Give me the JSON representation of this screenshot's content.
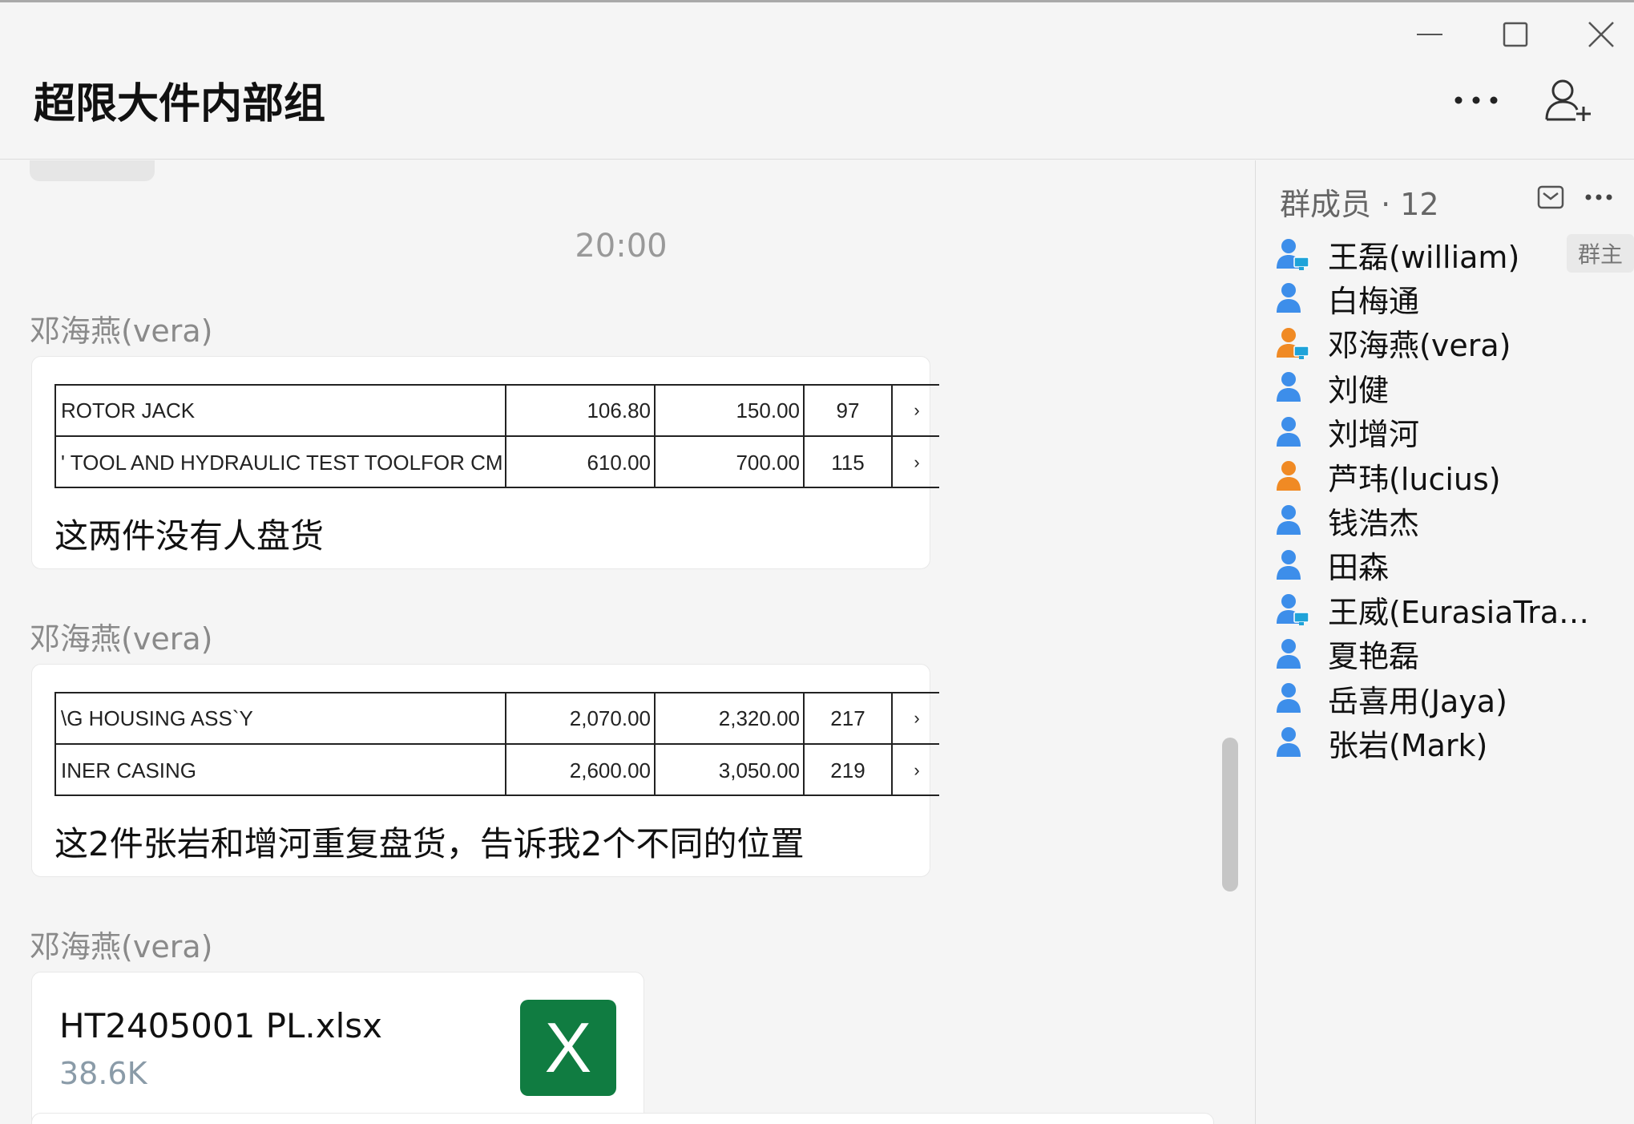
{
  "header": {
    "title": "超限大件内部组"
  },
  "chat": {
    "timestamp": "20:00",
    "messages": [
      {
        "sender": "邓海燕(vera)",
        "table": [
          [
            "ROTOR JACK",
            "106.80",
            "150.00",
            "97",
            "›"
          ],
          [
            "' TOOL AND HYDRAULIC TEST TOOLFOR CMV",
            "610.00",
            "700.00",
            "115",
            "›"
          ]
        ],
        "text": "这两件没有人盘货"
      },
      {
        "sender": "邓海燕(vera)",
        "table": [
          [
            "\\G HOUSING ASS`Y",
            "2,070.00",
            "2,320.00",
            "217",
            "›"
          ],
          [
            "INER CASING",
            "2,600.00",
            "3,050.00",
            "219",
            "›"
          ]
        ],
        "text": "这2件张岩和增河重复盘货，告诉我2个不同的位置"
      },
      {
        "sender": "邓海燕(vera)",
        "file": {
          "name": "HT2405001 PL.xlsx",
          "size": "38.6K",
          "icon_letter": "X",
          "icon": "excel-icon",
          "icon_color": "#107c41"
        }
      }
    ]
  },
  "members_panel": {
    "title": "群成员 · 12",
    "owner_badge": "群主",
    "members": [
      {
        "name": "王磊(william)",
        "icon": "user-pc-icon",
        "color": "#3d8eea"
      },
      {
        "name": "白梅通",
        "icon": "user-icon",
        "color": "#3d8eea"
      },
      {
        "name": "邓海燕(vera)",
        "icon": "user-pc-icon",
        "color": "#f08a24"
      },
      {
        "name": "刘健",
        "icon": "user-icon",
        "color": "#3d8eea"
      },
      {
        "name": "刘增河",
        "icon": "user-icon",
        "color": "#3d8eea"
      },
      {
        "name": "芦玮(lucius)",
        "icon": "user-icon",
        "color": "#f08a24"
      },
      {
        "name": "钱浩杰",
        "icon": "user-icon",
        "color": "#3d8eea"
      },
      {
        "name": "田森",
        "icon": "user-icon",
        "color": "#3d8eea"
      },
      {
        "name": "王威(EurasiaTransp...",
        "icon": "user-pc-icon",
        "color": "#3d8eea"
      },
      {
        "name": "夏艳磊",
        "icon": "user-icon",
        "color": "#3d8eea"
      },
      {
        "name": "岳喜用(Jaya)",
        "icon": "user-icon",
        "color": "#3d8eea"
      },
      {
        "name": "张岩(Mark)",
        "icon": "user-icon",
        "color": "#3d8eea"
      }
    ]
  }
}
